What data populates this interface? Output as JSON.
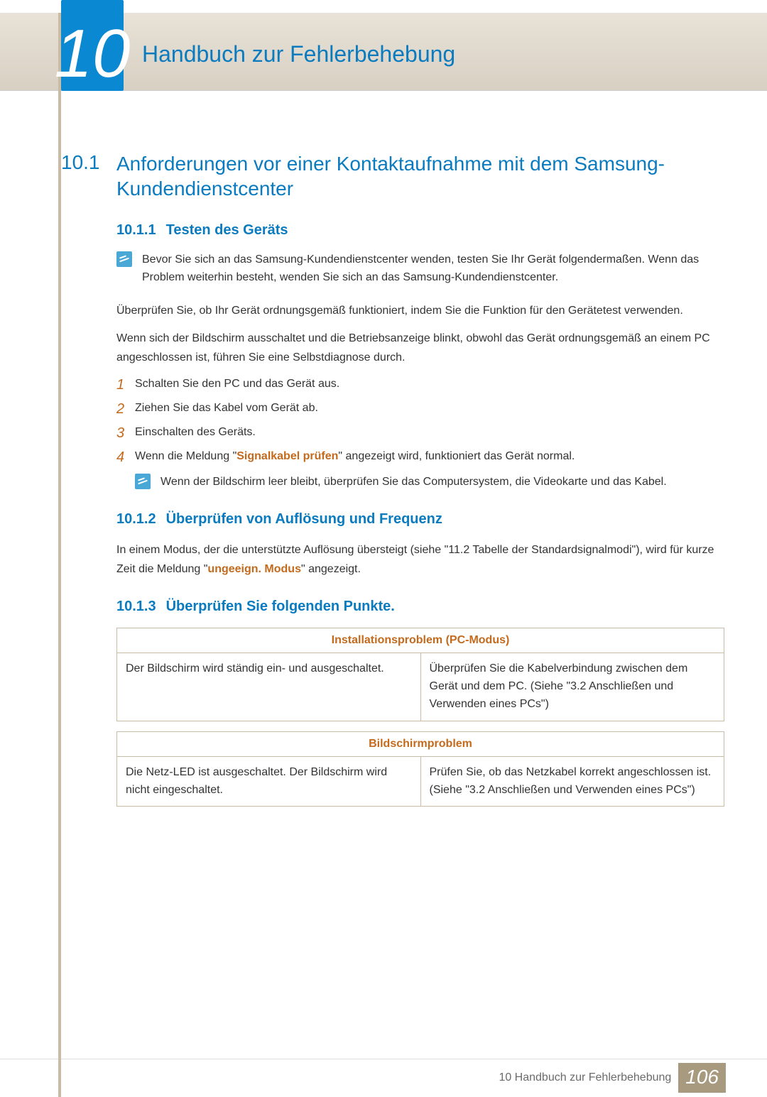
{
  "chapter": {
    "number": "10",
    "title": "Handbuch zur Fehlerbehebung"
  },
  "section_10_1": {
    "num": "10.1",
    "title": "Anforderungen vor einer Kontaktaufnahme mit dem Samsung-Kundendienstcenter"
  },
  "section_10_1_1": {
    "num": "10.1.1",
    "title": "Testen des Geräts",
    "note": "Bevor Sie sich an das Samsung-Kundendienstcenter wenden, testen Sie Ihr Gerät folgendermaßen. Wenn das Problem weiterhin besteht, wenden Sie sich an das Samsung-Kundendienstcenter.",
    "para1": "Überprüfen Sie, ob Ihr Gerät ordnungsgemäß funktioniert, indem Sie die Funktion für den Gerätetest verwenden.",
    "para2": "Wenn sich der Bildschirm ausschaltet und die Betriebsanzeige blinkt, obwohl das Gerät ordnungsgemäß an einem PC angeschlossen ist, führen Sie eine Selbstdiagnose durch.",
    "steps": {
      "s1": "Schalten Sie den PC und das Gerät aus.",
      "s2": "Ziehen Sie das Kabel vom Gerät ab.",
      "s3": "Einschalten des Geräts.",
      "s4_pre": "Wenn die Meldung \"",
      "s4_bold": "Signalkabel prüfen",
      "s4_post": "\" angezeigt wird, funktioniert das Gerät normal."
    },
    "nested_note": "Wenn der Bildschirm leer bleibt, überprüfen Sie das Computersystem, die Videokarte und das Kabel."
  },
  "section_10_1_2": {
    "num": "10.1.2",
    "title": "Überprüfen von Auflösung und Frequenz",
    "para_pre": "In einem Modus, der die unterstützte Auflösung übersteigt (siehe \"11.2 Tabelle der Standardsignalmodi\"), wird für kurze Zeit die Meldung \"",
    "para_bold": "ungeeign. Modus",
    "para_post": "\" angezeigt."
  },
  "section_10_1_3": {
    "num": "10.1.3",
    "title": "Überprüfen Sie folgenden Punkte.",
    "table1": {
      "header": "Installationsproblem (PC-Modus)",
      "left": "Der Bildschirm wird ständig ein- und ausgeschaltet.",
      "right": "Überprüfen Sie die Kabelverbindung zwischen dem Gerät und dem PC. (Siehe \"3.2 Anschließen und Verwenden eines PCs\")"
    },
    "table2": {
      "header": "Bildschirmproblem",
      "left": "Die Netz-LED ist ausgeschaltet. Der Bildschirm wird nicht eingeschaltet.",
      "right": "Prüfen Sie, ob das Netzkabel korrekt angeschlossen ist. (Siehe \"3.2 Anschließen und Verwenden eines PCs\")"
    }
  },
  "footer": {
    "text": "10 Handbuch zur Fehlerbehebung",
    "page": "106"
  },
  "step_numbers": {
    "n1": "1",
    "n2": "2",
    "n3": "3",
    "n4": "4"
  }
}
